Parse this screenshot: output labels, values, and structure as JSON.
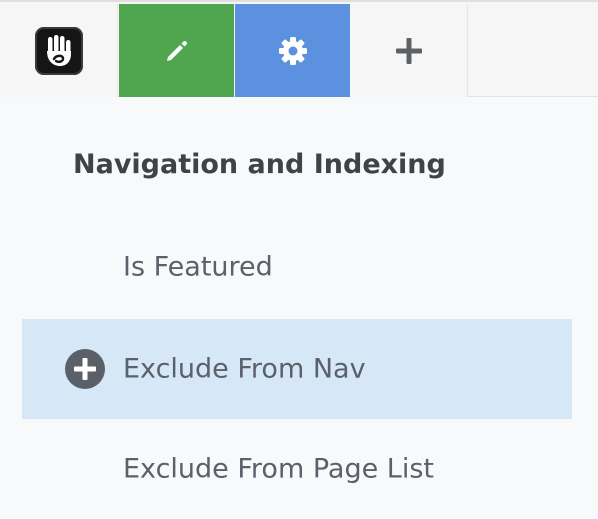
{
  "toolbar": {
    "buttons": [
      {
        "name": "concrete-logo",
        "icon": "concrete-hand-logo-icon"
      },
      {
        "name": "edit",
        "icon": "pencil-icon",
        "color": "#4fa64f"
      },
      {
        "name": "settings",
        "icon": "gear-icon",
        "color": "#5b91de"
      },
      {
        "name": "add",
        "icon": "plus-icon"
      }
    ]
  },
  "panel": {
    "section_title": "Navigation and Indexing",
    "items": [
      {
        "label": "Is Featured",
        "highlighted": false
      },
      {
        "label": "Exclude From Nav",
        "highlighted": true,
        "icon": "plus-circle-icon"
      },
      {
        "label": "Exclude From Page List",
        "highlighted": false
      }
    ],
    "highlight_color": "#d6e7f7"
  }
}
